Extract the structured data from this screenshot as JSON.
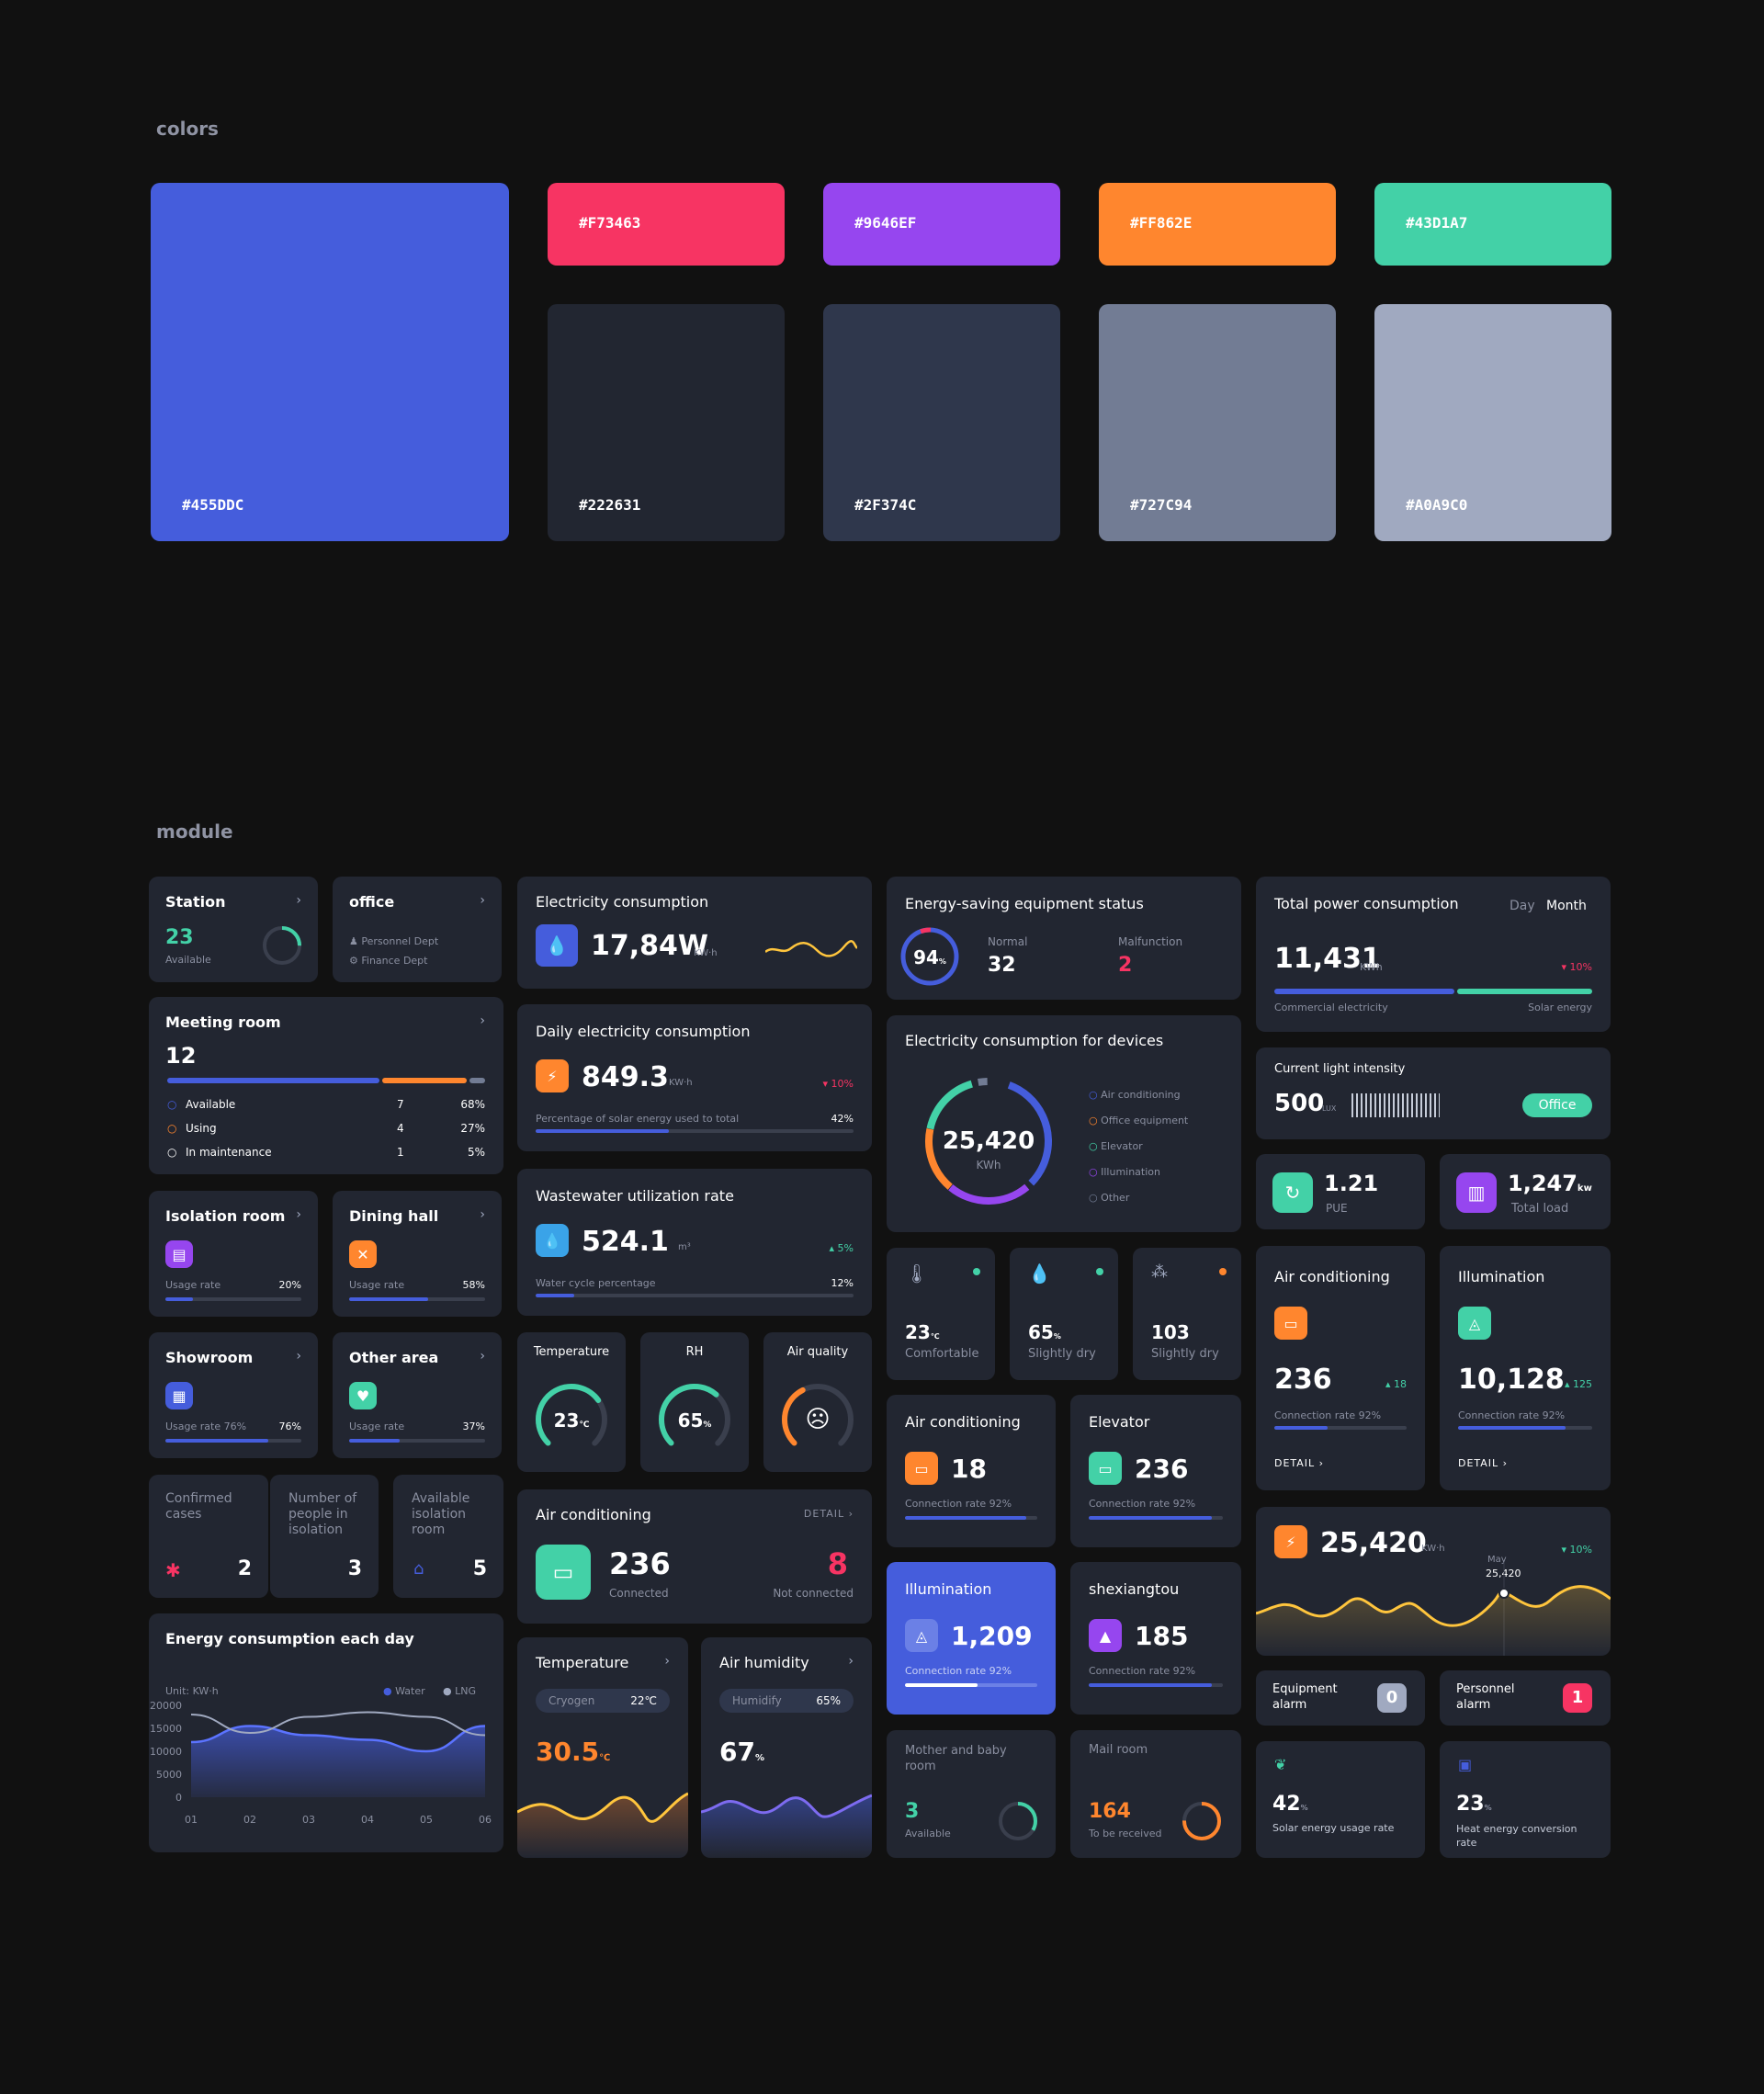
{
  "sections": {
    "colors": "colors",
    "module": "module"
  },
  "swatches": [
    {
      "hex": "#455DDC",
      "color": "#455ddc"
    },
    {
      "hex": "#F73463",
      "color": "#f73463"
    },
    {
      "hex": "#9646EF",
      "color": "#9646ef"
    },
    {
      "hex": "#FF862E",
      "color": "#ff862e"
    },
    {
      "hex": "#43D1A7",
      "color": "#43d1a7"
    },
    {
      "hex": "#222631",
      "color": "#222631"
    },
    {
      "hex": "#2F374C",
      "color": "#2f374c"
    },
    {
      "hex": "#727C94",
      "color": "#727c94"
    },
    {
      "hex": "#A0A9C0",
      "color": "#a0a9c0"
    }
  ],
  "station": {
    "title": "Station",
    "value": "23",
    "label": "Available"
  },
  "office": {
    "title": "office",
    "items": [
      "Personnel Dept",
      "Finance Dept"
    ]
  },
  "meeting": {
    "title": "Meeting room",
    "value": "12",
    "rows": [
      {
        "label": "Available",
        "count": "7",
        "pct": "68%"
      },
      {
        "label": "Using",
        "count": "4",
        "pct": "27%"
      },
      {
        "label": "In maintenance",
        "count": "1",
        "pct": "5%"
      }
    ],
    "shares": [
      0.68,
      0.27,
      0.05
    ]
  },
  "isolation": {
    "title": "Isolation room",
    "label": "Usage rate",
    "pct": "20%",
    "fill": 0.2
  },
  "dining": {
    "title": "Dining hall",
    "label": "Usage rate",
    "pct": "58%",
    "fill": 0.58
  },
  "showroom": {
    "title": "Showroom",
    "label": "Usage rate 76%",
    "pct": "76%",
    "fill": 0.76
  },
  "otherarea": {
    "title": "Other area",
    "label": "Usage rate",
    "pct": "37%",
    "fill": 0.37
  },
  "confirmed": {
    "label": "Confirmed cases",
    "value": "2"
  },
  "isolated": {
    "label": "Number of people in isolation",
    "value": "3"
  },
  "availiso": {
    "label": "Available isolation room",
    "value": "5"
  },
  "energyday": {
    "title": "Energy consumption each day",
    "unit": "Unit: KW·h",
    "legend": [
      "Water",
      "LNG"
    ]
  },
  "chart_data": {
    "type": "area",
    "title": "Energy consumption each day",
    "ylabel": "Unit: KW·h",
    "x": [
      "01",
      "02",
      "03",
      "04",
      "05",
      "06"
    ],
    "yticks": [
      "20000",
      "15000",
      "10000",
      "5000",
      "0"
    ],
    "ylim": [
      0,
      20000
    ],
    "series": [
      {
        "name": "Water",
        "values": [
          12000,
          15500,
          13500,
          12500,
          10000,
          15500
        ]
      },
      {
        "name": "LNG",
        "values": [
          18000,
          14000,
          17500,
          18500,
          17500,
          13500
        ]
      }
    ],
    "legend_position": "top-right"
  },
  "elec": {
    "title": "Electricity consumption",
    "value": "17,84W",
    "unit": "KW·h"
  },
  "daily": {
    "title": "Daily electricity consumption",
    "value": "849.3",
    "unit": "KW·h",
    "change": "10%",
    "label": "Percentage of solar energy used to total",
    "pct": "42%",
    "fill": 0.42
  },
  "waste": {
    "title": "Wastewater utilization rate",
    "value": "524.1",
    "unit": "m³",
    "change": "5%",
    "label": "Water cycle percentage",
    "pct": "12%",
    "fill": 0.12
  },
  "gtemp": {
    "title": "Temperature",
    "value": "23",
    "unit": "℃",
    "fill": 0.7
  },
  "grh": {
    "title": "RH",
    "value": "65",
    "unit": "%",
    "fill": 0.65
  },
  "gair": {
    "title": "Air quality",
    "fill": 0.4
  },
  "aircon_wide": {
    "title": "Air conditioning",
    "detail": "DETAIL",
    "value": "236",
    "label": "Connected",
    "value2": "8",
    "label2": "Not connected"
  },
  "temp2": {
    "title": "Temperature",
    "pill_label": "Cryogen",
    "pill_value": "22℃",
    "value": "30.5",
    "unit": "℃"
  },
  "hum2": {
    "title": "Air humidity",
    "pill_label": "Humidify",
    "pill_value": "65%",
    "value": "67",
    "unit": "%"
  },
  "esaving": {
    "title": "Energy-saving equipment status",
    "ring": "94",
    "ring_unit": "%",
    "normal_label": "Normal",
    "normal": "32",
    "mal_label": "Malfunction",
    "mal": "2"
  },
  "devices": {
    "title": "Electricity consumption for devices",
    "value": "25,420",
    "unit": "KWh",
    "legend": [
      {
        "name": "Air conditioning",
        "color": "#455ddc"
      },
      {
        "name": "Office equipment",
        "color": "#ff862e"
      },
      {
        "name": "Elevator",
        "color": "#43d1a7"
      },
      {
        "name": "Illumination",
        "color": "#9646ef"
      },
      {
        "name": "Other",
        "color": "#727c94"
      }
    ]
  },
  "sensors": [
    {
      "value": "23",
      "unit": "℃",
      "label": "Comfortable",
      "dot": "#43d1a7"
    },
    {
      "value": "65",
      "unit": "%",
      "label": "Slightly dry",
      "dot": "#43d1a7"
    },
    {
      "value": "103",
      "unit": "",
      "label": "Slightly dry",
      "dot": "#ff862e"
    }
  ],
  "ac_small": {
    "title": "Air conditioning",
    "value": "18",
    "label": "Connection rate 92%",
    "fill": 0.92
  },
  "elevator": {
    "title": "Elevator",
    "value": "236",
    "label": "Connection rate 92%",
    "fill": 0.92
  },
  "illum_small": {
    "title": "Illumination",
    "value": "1,209",
    "label": "Connection rate 92%",
    "fill": 0.55
  },
  "shex": {
    "title": "shexiangtou",
    "value": "185",
    "label": "Connection rate 92%",
    "fill": 0.92
  },
  "mother": {
    "title": "Mother and baby room",
    "value": "3",
    "label": "Available"
  },
  "mail": {
    "title": "Mail room",
    "value": "164",
    "label": "To be received"
  },
  "totalpower": {
    "title": "Total power consumption",
    "tab_day": "Day",
    "tab_month": "Month",
    "value": "11,431",
    "unit": "KWh",
    "change": "10%",
    "left": "Commercial electricity",
    "right": "Solar energy",
    "share": 0.57
  },
  "light": {
    "title": "Current light intensity",
    "value": "500",
    "unit": "LUX",
    "badge": "Office"
  },
  "pue": {
    "value": "1.21",
    "label": "PUE"
  },
  "load": {
    "value": "1,247",
    "unit": "kw",
    "label": "Total load"
  },
  "ac_big": {
    "title": "Air conditioning",
    "value": "236",
    "change": "18",
    "label": "Connection rate 92%",
    "detail": "DETAIL",
    "fill": 0.4
  },
  "illum_big": {
    "title": "Illumination",
    "value": "10,128",
    "change": "125",
    "label": "Connection rate 92%",
    "detail": "DETAIL",
    "fill": 0.8
  },
  "power_chart": {
    "value": "25,420",
    "unit": "KW·h",
    "change": "10%",
    "tip_month": "May",
    "tip_value": "25,420"
  },
  "eq_alarm": {
    "label": "Equipment alarm",
    "value": "0"
  },
  "per_alarm": {
    "label": "Personnel alarm",
    "value": "1"
  },
  "solar": {
    "value": "42",
    "unit": "%",
    "label": "Solar energy usage rate"
  },
  "heat": {
    "value": "23",
    "unit": "%",
    "label": "Heat energy conversion rate"
  }
}
